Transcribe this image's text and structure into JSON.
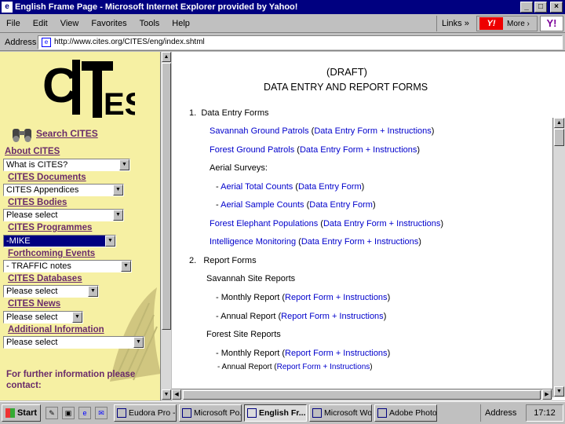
{
  "window": {
    "title": "English Frame Page - Microsoft Internet Explorer provided by Yahoo!",
    "min": "_",
    "max": "□",
    "close": "×"
  },
  "menu": {
    "items": [
      "File",
      "Edit",
      "View",
      "Favorites",
      "Tools",
      "Help"
    ],
    "links": "Links",
    "links_chevron": "»",
    "yahoo_more": "More ›"
  },
  "address": {
    "label": "Address",
    "url": "http://www.cites.org/CITES/eng/index.shtml"
  },
  "left": {
    "search": "Search CITES",
    "sections": [
      {
        "label": "About CITES",
        "select": "What is CITES?"
      },
      {
        "label": "CITES Documents",
        "select": "CITES Appendices"
      },
      {
        "label": "CITES Bodies",
        "select": "Please select"
      },
      {
        "label": "CITES Programmes",
        "select": "-MIKE"
      },
      {
        "label": "Forthcoming Events",
        "select": "- TRAFFIC notes"
      },
      {
        "label": "CITES Databases",
        "select": "Please select"
      },
      {
        "label": "CITES News",
        "select": "Please select"
      },
      {
        "label": "Additional Information",
        "select": "Please select"
      }
    ],
    "further": "For further information please contact:"
  },
  "right": {
    "draft": "(DRAFT)",
    "heading": "DATA ENTRY AND REPORT FORMS",
    "lines": [
      {
        "num": "1.",
        "text": "Data Entry Forms"
      },
      {
        "link": "Savannah Ground Patrols",
        "mid": " (",
        "link2": "Data Entry Form +  Instructions",
        "end": ")"
      },
      {
        "link": "Forest Ground Patrols",
        "mid": " (",
        "link2": "Data Entry Form +  Instructions",
        "end": ")"
      },
      {
        "text": "Aerial Surveys:"
      },
      {
        "pre": "- ",
        "link": "Aerial Total Counts",
        "mid": " (",
        "link2": "Data Entry Form",
        "end": ")"
      },
      {
        "pre": "- ",
        "link": "Aerial Sample Counts",
        "mid": " (",
        "link2": "Data Entry Form",
        "end": ")"
      },
      {
        "link": "Forest Elephant Populations",
        "mid": " (",
        "link2": "Data Entry Form +  Instructions",
        "end": ")"
      },
      {
        "link": "Intelligence Monitoring",
        "mid": " (",
        "link2": "Data Entry Form +  Instructions",
        "end": ")"
      },
      {
        "num": "2.",
        "text": "Report Forms"
      },
      {
        "text": "Savannah Site Reports"
      },
      {
        "pre": "- Monthly Report (",
        "link2": "Report Form +  Instructions",
        "end": ")"
      },
      {
        "pre": "- Annual Report (",
        "link2": "Report Form +  Instructions",
        "end": ")"
      },
      {
        "text": "Forest Site Reports"
      },
      {
        "pre": "- Monthly Report (",
        "link2": "Report Form +  Instructions",
        "end": ")"
      },
      {
        "pre": "- Annual Report (",
        "link2": "Report Form +  Instructions",
        "end": ")"
      }
    ]
  },
  "taskbar": {
    "start": "Start",
    "tasks": [
      "Eudora Pro - ...",
      "Microsoft Po...",
      "English Fr...",
      "Microsoft Wo...",
      "Adobe Photo..."
    ],
    "tray_address": "Address",
    "clock": "17:12"
  }
}
